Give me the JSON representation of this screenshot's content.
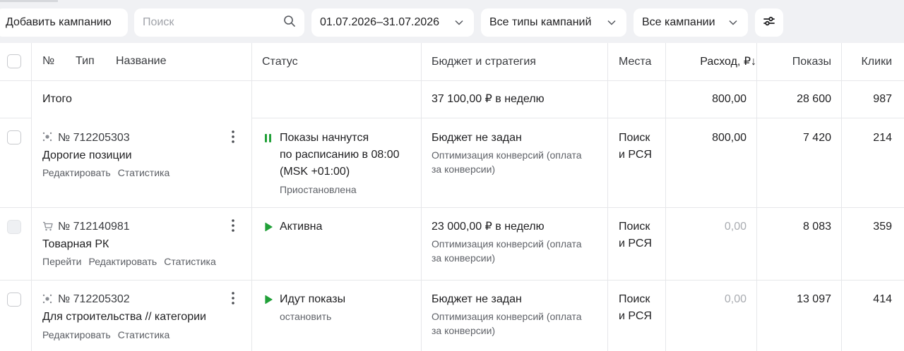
{
  "toolbar": {
    "add_campaign": "Добавить кампанию",
    "search_placeholder": "Поиск",
    "date_range": "01.07.2026–31.07.2026",
    "campaign_types": "Все типы кампаний",
    "campaigns": "Все кампании"
  },
  "table": {
    "headers": {
      "number": "№",
      "type": "Тип",
      "name": "Название",
      "status": "Статус",
      "budget": "Бюджет и стратегия",
      "places": "Места",
      "spend": "Расход, ₽↓",
      "impressions": "Показы",
      "clicks": "Клики"
    },
    "total": {
      "label": "Итого",
      "budget": "37 100,00 ₽ в неделю",
      "spend": "800,00",
      "impressions": "28 600",
      "clicks": "987"
    },
    "rows": [
      {
        "id": "№ 712205303",
        "name": "Дорогие позиции",
        "actions": [
          "Редактировать",
          "Статистика"
        ],
        "status_line1": "Показы начнутся",
        "status_line2": "по расписанию в 08:00",
        "status_line3": "(MSK +01:00)",
        "status_sub": "Приостановлена",
        "budget": "Бюджет не задан",
        "strategy_line1": "Оптимизация конверсий (оплата",
        "strategy_line2": "за конверсии)",
        "places_line1": "Поиск",
        "places_line2": "и РСЯ",
        "spend": "800,00",
        "impressions": "7 420",
        "clicks": "214"
      },
      {
        "id": "№ 712140981",
        "name": "Товарная РК",
        "actions": [
          "Перейти",
          "Редактировать",
          "Статистика"
        ],
        "status_line1": "Активна",
        "budget": "23 000,00 ₽ в неделю",
        "strategy_line1": "Оптимизация конверсий (оплата",
        "strategy_line2": "за конверсии)",
        "places_line1": "Поиск",
        "places_line2": "и РСЯ",
        "spend": "0,00",
        "impressions": "8 083",
        "clicks": "359"
      },
      {
        "id": "№ 712205302",
        "name": "Для строительства // категории",
        "actions": [
          "Редактировать",
          "Статистика"
        ],
        "status_line1": "Идут показы",
        "status_sub": "остановить",
        "budget": "Бюджет не задан",
        "strategy_line1": "Оптимизация конверсий (оплата",
        "strategy_line2": "за конверсии)",
        "places_line1": "Поиск",
        "places_line2": "и РСЯ",
        "spend": "0,00",
        "impressions": "13 097",
        "clicks": "414"
      }
    ]
  },
  "colors": {
    "status_green": "#21a038",
    "muted_text": "#a9acb1",
    "background": "#f0f1f4"
  },
  "icons": {
    "search": "search-icon",
    "chevron": "chevron-down-icon",
    "filter": "sliders-icon",
    "kebab": "more-vertical-icon",
    "pause": "pause-icon",
    "play": "play-icon",
    "unified_type": "unified-campaign-icon",
    "product_type": "shopping-cart-icon"
  }
}
